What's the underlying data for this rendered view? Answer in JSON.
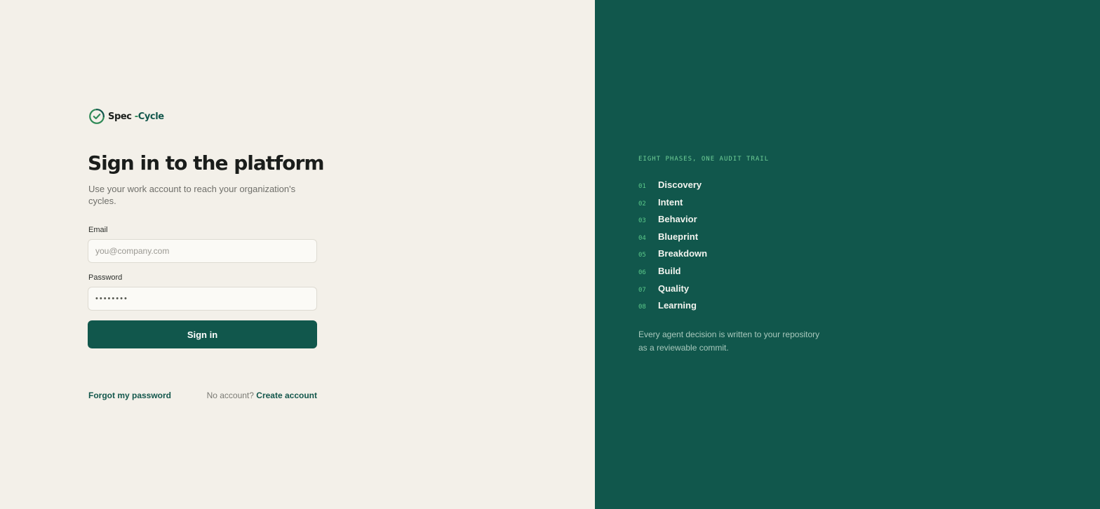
{
  "brand": {
    "name_part1": "Spec",
    "name_dash": " -",
    "name_part2": "Cycle",
    "icon": "check-cycle-icon",
    "colors": {
      "primary": "#11574c",
      "accent": "#2f8a57",
      "background": "#f3f0e9"
    }
  },
  "signin": {
    "title": "Sign in to the platform",
    "subtitle": "Use your work account to reach your organization's cycles.",
    "email_label": "Email",
    "email_placeholder": "you@company.com",
    "password_label": "Password",
    "password_value": "••••••••",
    "submit_label": "Sign in",
    "forgot_label": "Forgot my password",
    "no_account_text": "No account?",
    "create_account_label": "Create account"
  },
  "panel": {
    "eyebrow": "EIGHT PHASES, ONE AUDIT TRAIL",
    "phases": [
      {
        "num": "01",
        "name": "Discovery"
      },
      {
        "num": "02",
        "name": "Intent"
      },
      {
        "num": "03",
        "name": "Behavior"
      },
      {
        "num": "04",
        "name": "Blueprint"
      },
      {
        "num": "05",
        "name": "Breakdown"
      },
      {
        "num": "06",
        "name": "Build"
      },
      {
        "num": "07",
        "name": "Quality"
      },
      {
        "num": "08",
        "name": "Learning"
      }
    ],
    "footnote": "Every agent decision is written to your repository as a reviewable commit."
  }
}
